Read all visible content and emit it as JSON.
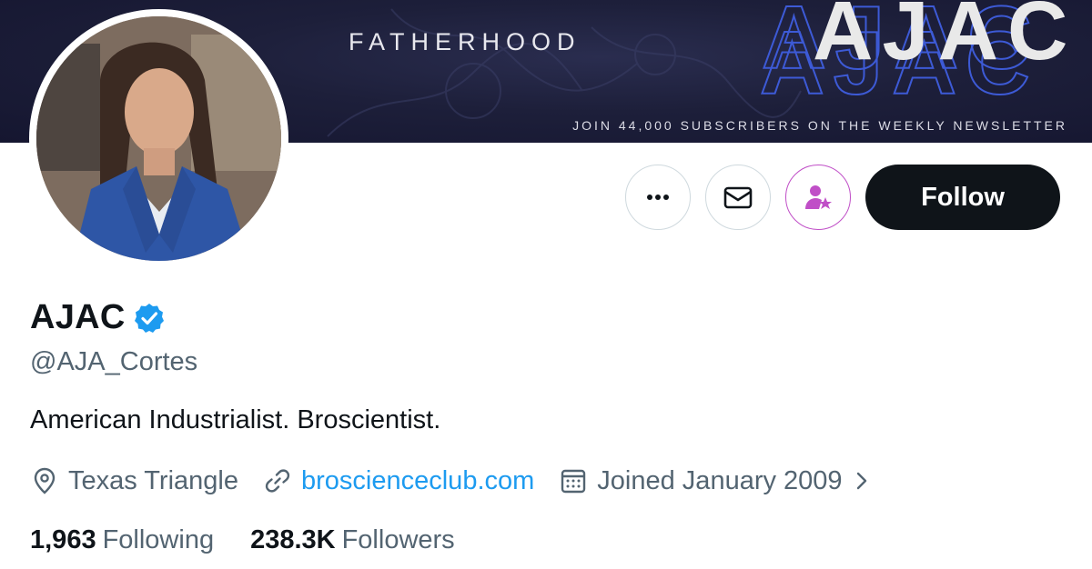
{
  "banner": {
    "tagline": "FATHERHOOD",
    "logo_text": "AJAC",
    "subtext": "JOIN 44,000 SUBSCRIBERS ON THE WEEKLY NEWSLETTER",
    "background_color": "#1d1f3a"
  },
  "avatar": {
    "description_icon": "profile-photo"
  },
  "actions": {
    "more_icon": "more-dots-icon",
    "message_icon": "envelope-icon",
    "subscribe_icon": "person-star-icon",
    "follow_label": "Follow",
    "subscribe_color": "#c04fc7"
  },
  "profile": {
    "display_name": "AJAC",
    "verified": true,
    "verified_color": "#1d9bf0",
    "handle": "@AJA_Cortes",
    "bio": "American Industrialist. Broscientist."
  },
  "meta": {
    "location": "Texas Triangle",
    "website": "broscienceclub.com",
    "joined": "Joined January 2009"
  },
  "stats": {
    "following_count": "1,963",
    "following_label": "Following",
    "followers_count": "238.3K",
    "followers_label": "Followers"
  }
}
